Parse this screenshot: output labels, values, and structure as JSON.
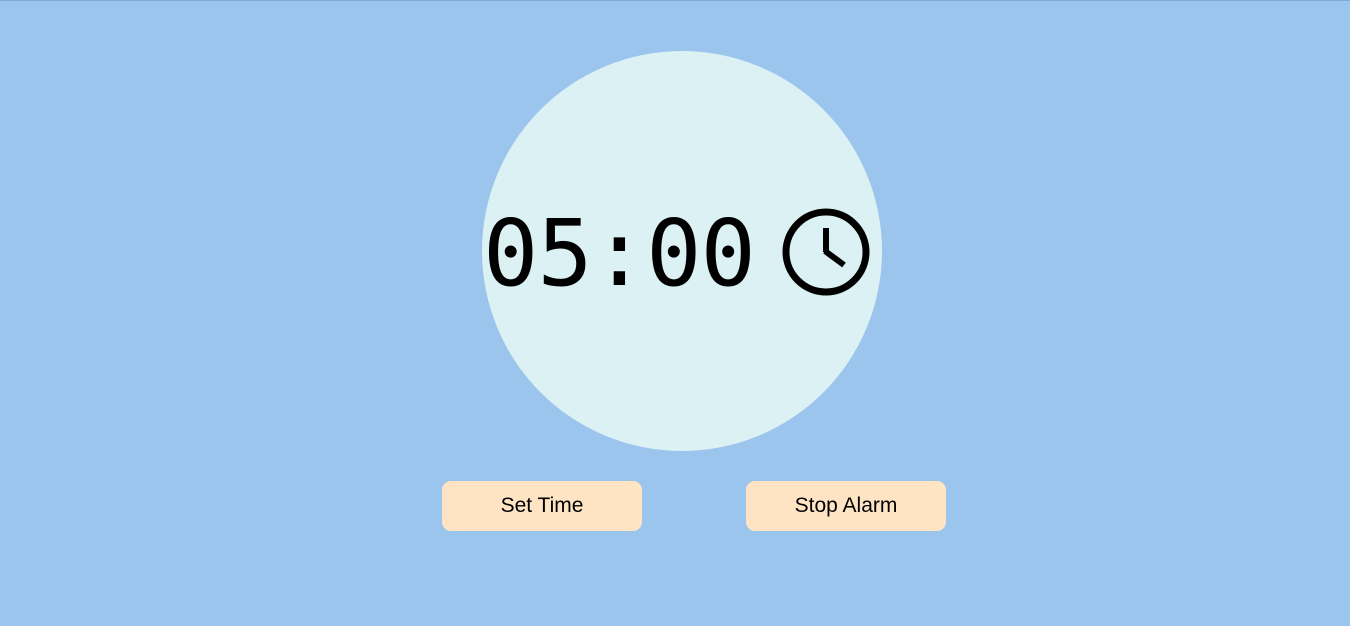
{
  "colors": {
    "background": "#9cc5ee",
    "clock_face": "#dcf1f3",
    "button": "#ffe4c4",
    "text": "#000000"
  },
  "timer": {
    "display": "05:00",
    "icon": "clock-icon"
  },
  "buttons": {
    "set_time_label": "Set Time",
    "stop_alarm_label": "Stop Alarm"
  }
}
